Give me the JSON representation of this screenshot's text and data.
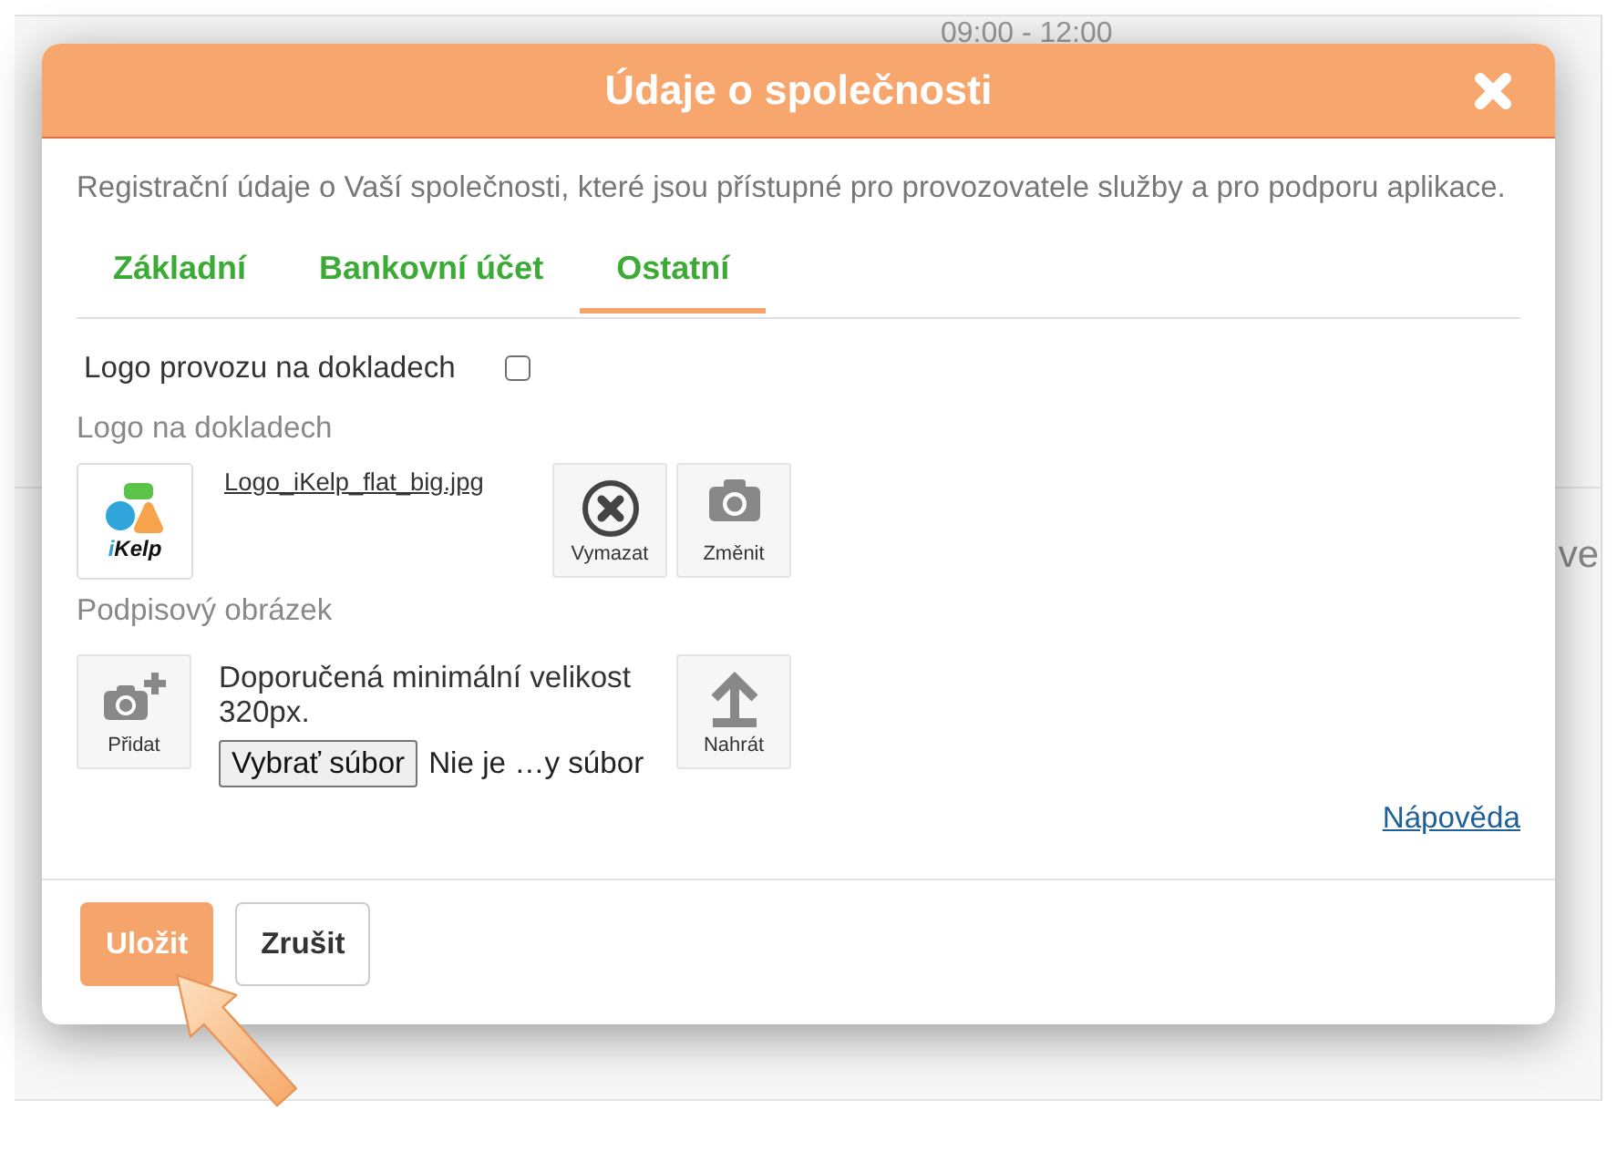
{
  "background": {
    "time_range": "09:00 - 12:00",
    "partial_text": "ve"
  },
  "dialog": {
    "title": "Údaje o společnosti",
    "description": "Registrační údaje o Vaší společnosti, které jsou přístupné pro provozovatele služby a pro podporu aplikace.",
    "tabs": [
      {
        "label": "Základní",
        "selected": false
      },
      {
        "label": "Bankovní účet",
        "selected": false
      },
      {
        "label": "Ostatní",
        "selected": true
      }
    ],
    "logo_toggle": {
      "label": "Logo provozu na dokladech",
      "checked": false
    },
    "logo_section": {
      "label": "Logo na dokladech",
      "logo_text": "iKelp",
      "file_name": "Logo_iKelp_flat_big.jpg",
      "actions": [
        {
          "kind": "delete",
          "label": "Vymazat"
        },
        {
          "kind": "change",
          "label": "Změnit"
        }
      ]
    },
    "signature_section": {
      "label": "Podpisový obrázek",
      "add_button": {
        "kind": "add",
        "label": "Přidat"
      },
      "hint": "Doporučená minimální velikost 320px.",
      "choose_file_button": "Vybrať súbor",
      "file_status": "Nie je …y súbor",
      "upload_button": {
        "kind": "upload",
        "label": "Nahrát"
      }
    },
    "help_link": "Nápověda",
    "buttons": [
      {
        "kind": "primary",
        "label": "Uložit"
      },
      {
        "kind": "secondary",
        "label": "Zrušit"
      }
    ]
  }
}
